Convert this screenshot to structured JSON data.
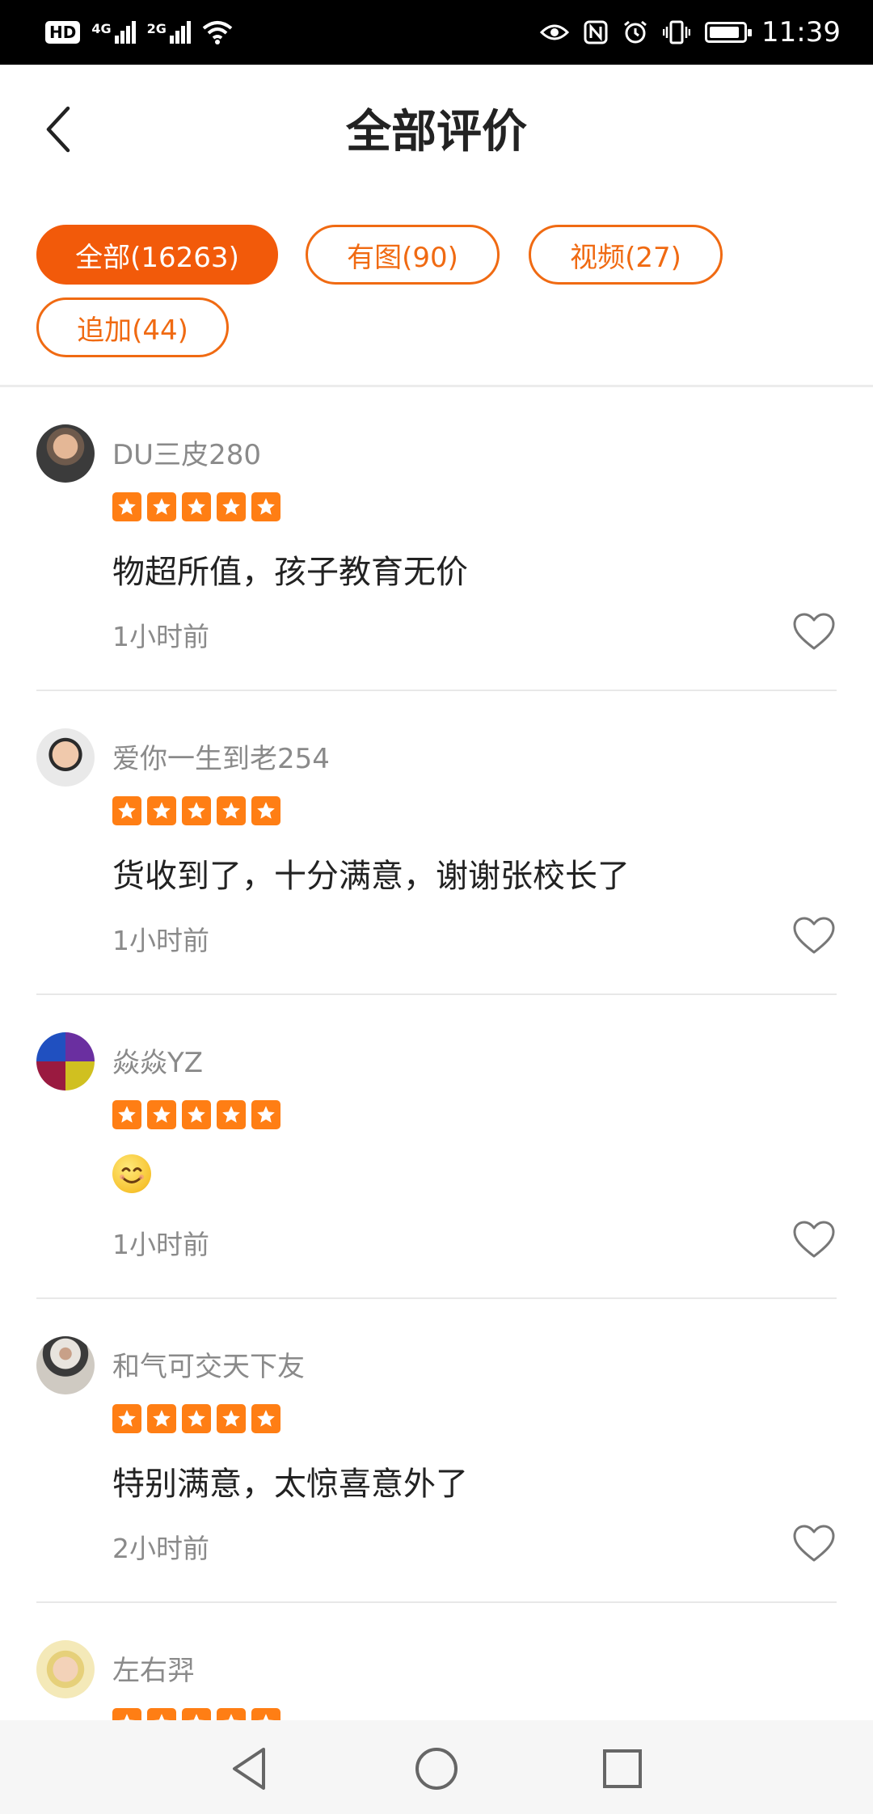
{
  "status_bar": {
    "badge": "HD",
    "net1": "4G",
    "net2": "2G",
    "time": "11:39",
    "battery_level": 0.9,
    "icons": [
      "eye-icon",
      "nfc-icon",
      "alarm-icon",
      "vibrate-icon",
      "battery-icon"
    ]
  },
  "header": {
    "title": "全部评价",
    "back_icon": "chevron-left-icon"
  },
  "filters": [
    {
      "label": "全部(16263)",
      "active": true
    },
    {
      "label": "有图(90)",
      "active": false
    },
    {
      "label": "视频(27)",
      "active": false
    },
    {
      "label": "追加(44)",
      "active": false
    }
  ],
  "reviews": [
    {
      "user": "DU三皮280",
      "rating": 5,
      "text": "物超所值，孩子教育无价",
      "time": "1小时前"
    },
    {
      "user": "爱你一生到老254",
      "rating": 5,
      "text": "货收到了，十分满意，谢谢张校长了",
      "time": "1小时前"
    },
    {
      "user": "焱焱YZ",
      "rating": 5,
      "text": "",
      "emoji": "smiling-face-emoji",
      "time": "1小时前"
    },
    {
      "user": "和气可交天下友",
      "rating": 5,
      "text": "特别满意，太惊喜意外了",
      "time": "2小时前"
    },
    {
      "user": "左右羿",
      "rating": 5,
      "text": "",
      "time": ""
    }
  ],
  "colors": {
    "accent": "#f25a0a",
    "star": "#ff7e14",
    "muted_text": "#8a8a8a"
  }
}
